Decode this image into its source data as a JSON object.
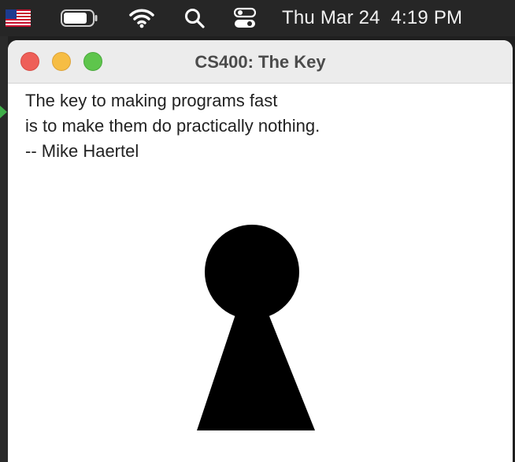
{
  "menubar": {
    "clock": "Thu Mar 24  4:19 PM",
    "icons": [
      "us-flag-icon",
      "battery-icon",
      "wifi-icon",
      "search-icon",
      "control-center-icon"
    ]
  },
  "window": {
    "title": "CS400: The Key",
    "quote": {
      "line1": "The key to making programs fast",
      "line2": "is to make them do practically nothing.",
      "line3": "-- Mike Haertel"
    },
    "colors": {
      "close": "#ee5f58",
      "minimize": "#f6bd44",
      "maximize": "#5ec54c",
      "keyhole": "#000000"
    }
  }
}
